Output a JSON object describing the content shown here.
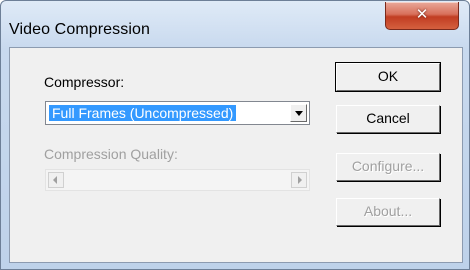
{
  "window": {
    "title": "Video Compression"
  },
  "compressor": {
    "label": "Compressor:",
    "selected": "Full Frames (Uncompressed)"
  },
  "quality": {
    "label": "Compression Quality:"
  },
  "buttons": {
    "ok": "OK",
    "cancel": "Cancel",
    "configure": "Configure...",
    "about": "About..."
  },
  "colors": {
    "selection": "#3399ff",
    "close_button": "#c13d22",
    "disabled_text": "#a0a0a0"
  }
}
